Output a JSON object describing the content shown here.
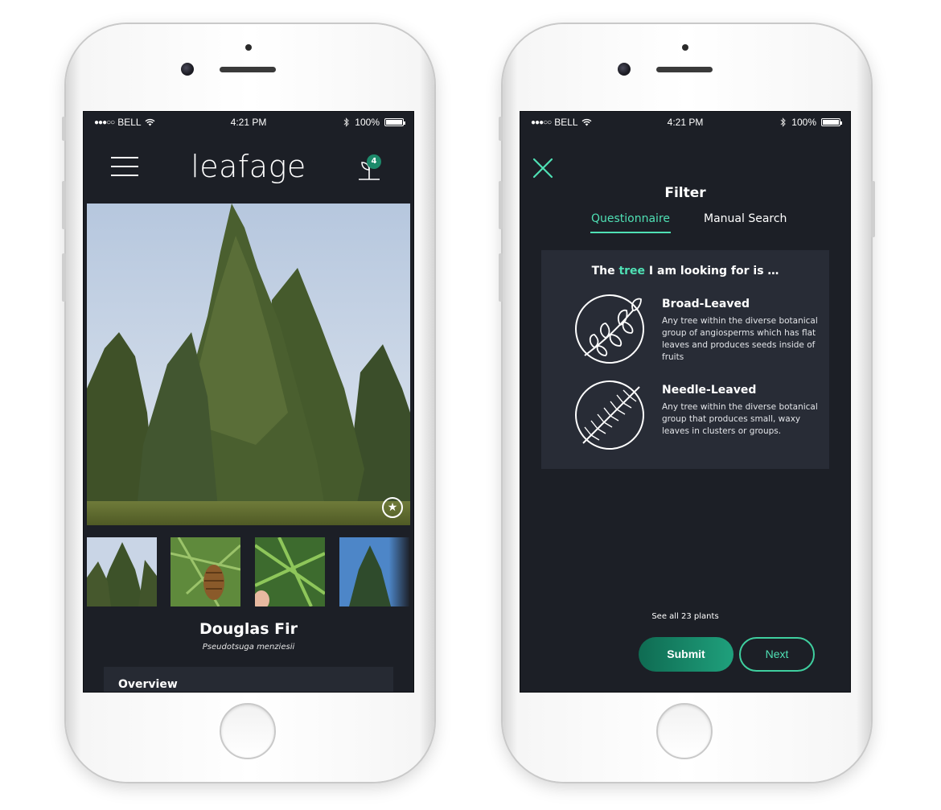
{
  "status_bar": {
    "carrier": "BELL",
    "signal_dots": "●●●○○",
    "time": "4:21 PM",
    "battery": "100%"
  },
  "detail_screen": {
    "logo": "leafage",
    "plant_count": "4",
    "plant_name": "Douglas Fir",
    "scientific_name": "Pseudotsuga menziesii",
    "overview_title": "Overview"
  },
  "filter_screen": {
    "title": "Filter",
    "tabs": [
      "Questionnaire",
      "Manual Search"
    ],
    "active_tab": "Questionnaire",
    "question_prefix": "The",
    "question_accent": "tree",
    "question_suffix": "I am looking for is …",
    "options": [
      {
        "title": "Broad-Leaved",
        "description": "Any tree within the diverse botanical group of angiosperms which has flat leaves and produces seeds inside of fruits",
        "icon": "broad-leaf-branch-icon"
      },
      {
        "title": "Needle-Leaved",
        "description": "Any tree within the diverse botanical group that produces small, waxy leaves in clusters or groups.",
        "icon": "needle-leaf-branch-icon"
      }
    ],
    "see_all": "See all 23 plants",
    "submit_label": "Submit",
    "next_label": "Next"
  },
  "colors": {
    "screen_bg": "#1c1f26",
    "card_bg": "#282c36",
    "accent": "#4fe0b4",
    "submit_gradient_start": "#0f6b52",
    "submit_gradient_end": "#1fa07c",
    "badge": "#1d8a6b"
  }
}
